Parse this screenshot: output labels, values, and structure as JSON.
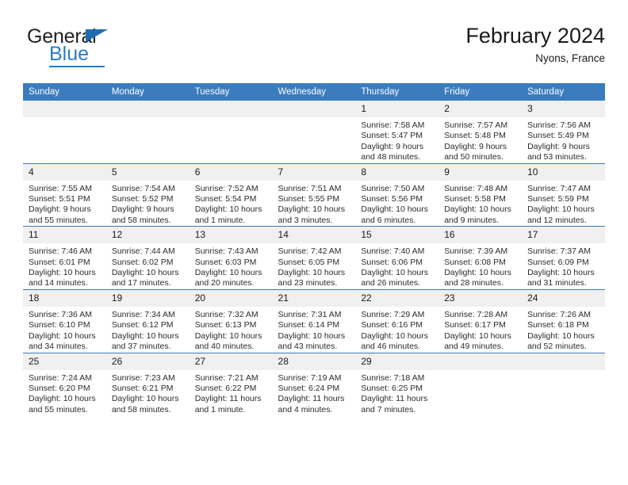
{
  "brand": {
    "name_top": "General",
    "name_bottom": "Blue",
    "accent_color": "#2a7cc7",
    "triangle_color": "#1f6cb4"
  },
  "header": {
    "title": "February 2024",
    "subtitle": "Nyons, France"
  },
  "theme": {
    "header_bg": "#3a7cbe",
    "header_text": "#ffffff",
    "daynum_bg": "#f0f0f0",
    "cell_bg": "#ffffff",
    "grid_line": "#3a7cbe",
    "body_text": "#2b2b2b"
  },
  "weekdays": [
    "Sunday",
    "Monday",
    "Tuesday",
    "Wednesday",
    "Thursday",
    "Friday",
    "Saturday"
  ],
  "labels": {
    "sunrise_prefix": "Sunrise:",
    "sunset_prefix": "Sunset:",
    "daylight_prefix": "Daylight:"
  },
  "weeks": [
    [
      {
        "day": "",
        "blank": true,
        "sunrise": "",
        "sunset": "",
        "daylight_1": "",
        "daylight_2": ""
      },
      {
        "day": "",
        "blank": true,
        "sunrise": "",
        "sunset": "",
        "daylight_1": "",
        "daylight_2": ""
      },
      {
        "day": "",
        "blank": true,
        "sunrise": "",
        "sunset": "",
        "daylight_1": "",
        "daylight_2": ""
      },
      {
        "day": "",
        "blank": true,
        "sunrise": "",
        "sunset": "",
        "daylight_1": "",
        "daylight_2": ""
      },
      {
        "day": "1",
        "blank": false,
        "sunrise": "Sunrise: 7:58 AM",
        "sunset": "Sunset: 5:47 PM",
        "daylight_1": "Daylight: 9 hours",
        "daylight_2": "and 48 minutes."
      },
      {
        "day": "2",
        "blank": false,
        "sunrise": "Sunrise: 7:57 AM",
        "sunset": "Sunset: 5:48 PM",
        "daylight_1": "Daylight: 9 hours",
        "daylight_2": "and 50 minutes."
      },
      {
        "day": "3",
        "blank": false,
        "sunrise": "Sunrise: 7:56 AM",
        "sunset": "Sunset: 5:49 PM",
        "daylight_1": "Daylight: 9 hours",
        "daylight_2": "and 53 minutes."
      }
    ],
    [
      {
        "day": "4",
        "blank": false,
        "sunrise": "Sunrise: 7:55 AM",
        "sunset": "Sunset: 5:51 PM",
        "daylight_1": "Daylight: 9 hours",
        "daylight_2": "and 55 minutes."
      },
      {
        "day": "5",
        "blank": false,
        "sunrise": "Sunrise: 7:54 AM",
        "sunset": "Sunset: 5:52 PM",
        "daylight_1": "Daylight: 9 hours",
        "daylight_2": "and 58 minutes."
      },
      {
        "day": "6",
        "blank": false,
        "sunrise": "Sunrise: 7:52 AM",
        "sunset": "Sunset: 5:54 PM",
        "daylight_1": "Daylight: 10 hours",
        "daylight_2": "and 1 minute."
      },
      {
        "day": "7",
        "blank": false,
        "sunrise": "Sunrise: 7:51 AM",
        "sunset": "Sunset: 5:55 PM",
        "daylight_1": "Daylight: 10 hours",
        "daylight_2": "and 3 minutes."
      },
      {
        "day": "8",
        "blank": false,
        "sunrise": "Sunrise: 7:50 AM",
        "sunset": "Sunset: 5:56 PM",
        "daylight_1": "Daylight: 10 hours",
        "daylight_2": "and 6 minutes."
      },
      {
        "day": "9",
        "blank": false,
        "sunrise": "Sunrise: 7:48 AM",
        "sunset": "Sunset: 5:58 PM",
        "daylight_1": "Daylight: 10 hours",
        "daylight_2": "and 9 minutes."
      },
      {
        "day": "10",
        "blank": false,
        "sunrise": "Sunrise: 7:47 AM",
        "sunset": "Sunset: 5:59 PM",
        "daylight_1": "Daylight: 10 hours",
        "daylight_2": "and 12 minutes."
      }
    ],
    [
      {
        "day": "11",
        "blank": false,
        "sunrise": "Sunrise: 7:46 AM",
        "sunset": "Sunset: 6:01 PM",
        "daylight_1": "Daylight: 10 hours",
        "daylight_2": "and 14 minutes."
      },
      {
        "day": "12",
        "blank": false,
        "sunrise": "Sunrise: 7:44 AM",
        "sunset": "Sunset: 6:02 PM",
        "daylight_1": "Daylight: 10 hours",
        "daylight_2": "and 17 minutes."
      },
      {
        "day": "13",
        "blank": false,
        "sunrise": "Sunrise: 7:43 AM",
        "sunset": "Sunset: 6:03 PM",
        "daylight_1": "Daylight: 10 hours",
        "daylight_2": "and 20 minutes."
      },
      {
        "day": "14",
        "blank": false,
        "sunrise": "Sunrise: 7:42 AM",
        "sunset": "Sunset: 6:05 PM",
        "daylight_1": "Daylight: 10 hours",
        "daylight_2": "and 23 minutes."
      },
      {
        "day": "15",
        "blank": false,
        "sunrise": "Sunrise: 7:40 AM",
        "sunset": "Sunset: 6:06 PM",
        "daylight_1": "Daylight: 10 hours",
        "daylight_2": "and 26 minutes."
      },
      {
        "day": "16",
        "blank": false,
        "sunrise": "Sunrise: 7:39 AM",
        "sunset": "Sunset: 6:08 PM",
        "daylight_1": "Daylight: 10 hours",
        "daylight_2": "and 28 minutes."
      },
      {
        "day": "17",
        "blank": false,
        "sunrise": "Sunrise: 7:37 AM",
        "sunset": "Sunset: 6:09 PM",
        "daylight_1": "Daylight: 10 hours",
        "daylight_2": "and 31 minutes."
      }
    ],
    [
      {
        "day": "18",
        "blank": false,
        "sunrise": "Sunrise: 7:36 AM",
        "sunset": "Sunset: 6:10 PM",
        "daylight_1": "Daylight: 10 hours",
        "daylight_2": "and 34 minutes."
      },
      {
        "day": "19",
        "blank": false,
        "sunrise": "Sunrise: 7:34 AM",
        "sunset": "Sunset: 6:12 PM",
        "daylight_1": "Daylight: 10 hours",
        "daylight_2": "and 37 minutes."
      },
      {
        "day": "20",
        "blank": false,
        "sunrise": "Sunrise: 7:32 AM",
        "sunset": "Sunset: 6:13 PM",
        "daylight_1": "Daylight: 10 hours",
        "daylight_2": "and 40 minutes."
      },
      {
        "day": "21",
        "blank": false,
        "sunrise": "Sunrise: 7:31 AM",
        "sunset": "Sunset: 6:14 PM",
        "daylight_1": "Daylight: 10 hours",
        "daylight_2": "and 43 minutes."
      },
      {
        "day": "22",
        "blank": false,
        "sunrise": "Sunrise: 7:29 AM",
        "sunset": "Sunset: 6:16 PM",
        "daylight_1": "Daylight: 10 hours",
        "daylight_2": "and 46 minutes."
      },
      {
        "day": "23",
        "blank": false,
        "sunrise": "Sunrise: 7:28 AM",
        "sunset": "Sunset: 6:17 PM",
        "daylight_1": "Daylight: 10 hours",
        "daylight_2": "and 49 minutes."
      },
      {
        "day": "24",
        "blank": false,
        "sunrise": "Sunrise: 7:26 AM",
        "sunset": "Sunset: 6:18 PM",
        "daylight_1": "Daylight: 10 hours",
        "daylight_2": "and 52 minutes."
      }
    ],
    [
      {
        "day": "25",
        "blank": false,
        "sunrise": "Sunrise: 7:24 AM",
        "sunset": "Sunset: 6:20 PM",
        "daylight_1": "Daylight: 10 hours",
        "daylight_2": "and 55 minutes."
      },
      {
        "day": "26",
        "blank": false,
        "sunrise": "Sunrise: 7:23 AM",
        "sunset": "Sunset: 6:21 PM",
        "daylight_1": "Daylight: 10 hours",
        "daylight_2": "and 58 minutes."
      },
      {
        "day": "27",
        "blank": false,
        "sunrise": "Sunrise: 7:21 AM",
        "sunset": "Sunset: 6:22 PM",
        "daylight_1": "Daylight: 11 hours",
        "daylight_2": "and 1 minute."
      },
      {
        "day": "28",
        "blank": false,
        "sunrise": "Sunrise: 7:19 AM",
        "sunset": "Sunset: 6:24 PM",
        "daylight_1": "Daylight: 11 hours",
        "daylight_2": "and 4 minutes."
      },
      {
        "day": "29",
        "blank": false,
        "sunrise": "Sunrise: 7:18 AM",
        "sunset": "Sunset: 6:25 PM",
        "daylight_1": "Daylight: 11 hours",
        "daylight_2": "and 7 minutes."
      },
      {
        "day": "",
        "blank": true,
        "sunrise": "",
        "sunset": "",
        "daylight_1": "",
        "daylight_2": ""
      },
      {
        "day": "",
        "blank": true,
        "sunrise": "",
        "sunset": "",
        "daylight_1": "",
        "daylight_2": ""
      }
    ]
  ]
}
